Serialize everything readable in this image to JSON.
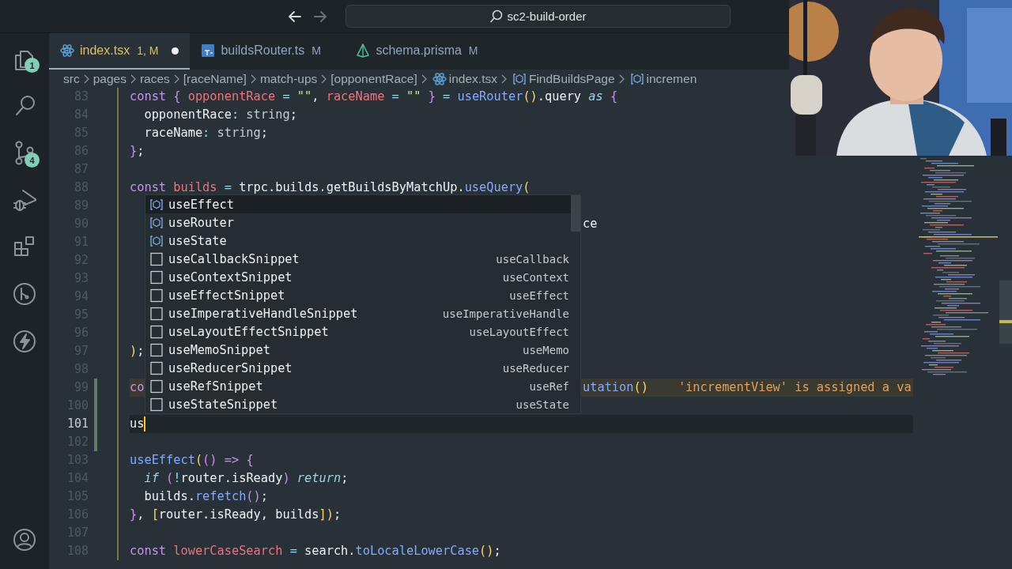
{
  "title_bar": {
    "nav": [
      {
        "kind": "back",
        "disabled": false
      },
      {
        "kind": "forward",
        "disabled": true
      }
    ],
    "command_center": {
      "label": "sc2-build-order"
    }
  },
  "activity_bar": {
    "items": [
      {
        "kind": "files",
        "badge": "1"
      },
      {
        "kind": "search"
      },
      {
        "kind": "source-control",
        "badge": "4"
      },
      {
        "kind": "run-debug"
      },
      {
        "kind": "extensions"
      },
      {
        "kind": "git-graph"
      },
      {
        "kind": "lightning"
      }
    ],
    "bottom_items": [
      {
        "kind": "account"
      }
    ]
  },
  "tabs": [
    {
      "kind": "react",
      "label": "index.tsx",
      "status": "1, M",
      "dirty": true,
      "selected": true
    },
    {
      "kind": "ts",
      "label": "buildsRouter.ts",
      "status": "M",
      "dirty": false,
      "selected": false
    },
    {
      "kind": "prisma",
      "label": "schema.prisma",
      "status": "M",
      "dirty": false,
      "selected": false
    }
  ],
  "breadcrumb": [
    {
      "label": "src"
    },
    {
      "label": "pages"
    },
    {
      "label": "races"
    },
    {
      "label": "[raceName]"
    },
    {
      "label": "match-ups"
    },
    {
      "label": "[opponentRace]"
    },
    {
      "label": "index.tsx",
      "kind": "react"
    },
    {
      "label": "FindBuildsPage",
      "kind": "symbol"
    },
    {
      "label": "incremen",
      "kind": "symbol"
    }
  ],
  "editor": {
    "lines": [
      {
        "number": "83",
        "tokens": [
          {
            "text": "const ",
            "kind": "kw"
          },
          {
            "text": "{ ",
            "kind": "brace"
          },
          {
            "text": "opponentRace ",
            "kind": "var"
          },
          {
            "text": "= ",
            "kind": "op"
          },
          {
            "text": "\"\"",
            "kind": "str"
          },
          {
            "text": ", ",
            "kind": "txt"
          },
          {
            "text": "raceName ",
            "kind": "var"
          },
          {
            "text": "= ",
            "kind": "op"
          },
          {
            "text": "\"\" ",
            "kind": "str"
          },
          {
            "text": "} ",
            "kind": "brace"
          },
          {
            "text": "= ",
            "kind": "op"
          },
          {
            "text": "useRouter",
            "kind": "fn"
          },
          {
            "text": "()",
            "kind": "paren"
          },
          {
            "text": ".query ",
            "kind": "txt"
          },
          {
            "text": "as ",
            "kind": "ctrl"
          },
          {
            "text": "{",
            "kind": "brace"
          }
        ]
      },
      {
        "number": "84",
        "tokens": [
          {
            "text": "  opponentRace",
            "kind": "txt"
          },
          {
            "text": ": ",
            "kind": "op"
          },
          {
            "text": "string",
            "kind": "type"
          },
          {
            "text": ";",
            "kind": "txt"
          }
        ]
      },
      {
        "number": "85",
        "tokens": [
          {
            "text": "  raceName",
            "kind": "txt"
          },
          {
            "text": ": ",
            "kind": "op"
          },
          {
            "text": "string",
            "kind": "type"
          },
          {
            "text": ";",
            "kind": "txt"
          }
        ]
      },
      {
        "number": "86",
        "tokens": [
          {
            "text": "}",
            "kind": "brace"
          },
          {
            "text": ";",
            "kind": "txt"
          }
        ]
      },
      {
        "number": "87"
      },
      {
        "number": "88",
        "tokens": [
          {
            "text": "const ",
            "kind": "kw"
          },
          {
            "text": "builds ",
            "kind": "var"
          },
          {
            "text": "= ",
            "kind": "op"
          },
          {
            "text": "trpc.builds.getBuildsByMatchUp.",
            "kind": "txt"
          },
          {
            "text": "useQuery",
            "kind": "fn"
          },
          {
            "text": "(",
            "kind": "paren"
          }
        ]
      },
      {
        "number": "89"
      },
      {
        "number": "90",
        "right_tokens": [
          {
            "text": "ce",
            "kind": "txt"
          }
        ]
      },
      {
        "number": "91"
      },
      {
        "number": "92"
      },
      {
        "number": "93"
      },
      {
        "number": "94"
      },
      {
        "number": "95"
      },
      {
        "number": "96"
      },
      {
        "number": "97",
        "tokens": [
          {
            "text": ")",
            "kind": "paren"
          },
          {
            "text": ";",
            "kind": "txt"
          }
        ]
      },
      {
        "number": "98"
      },
      {
        "number": "99",
        "tokens": [
          {
            "text": "co",
            "kind": "kw"
          }
        ],
        "right_tokens": [
          {
            "text": "utation",
            "kind": "fn"
          },
          {
            "text": "()",
            "kind": "paren"
          }
        ],
        "diagnostic": "'incrementView' is assigned a va",
        "warning": true,
        "changed": true
      },
      {
        "number": "100",
        "changed": true
      },
      {
        "number": "101",
        "tokens": [
          {
            "text": "us",
            "kind": "txt"
          }
        ],
        "current": true,
        "changed": true
      },
      {
        "number": "102",
        "changed": true
      },
      {
        "number": "103",
        "tokens": [
          {
            "text": "useEffect",
            "kind": "fn"
          },
          {
            "text": "(",
            "kind": "paren"
          },
          {
            "text": "() ",
            "kind": "paren2"
          },
          {
            "text": "=> ",
            "kind": "kw"
          },
          {
            "text": "{",
            "kind": "brace"
          }
        ]
      },
      {
        "number": "104",
        "tokens": [
          {
            "text": "  if ",
            "kind": "ctrl"
          },
          {
            "text": "(",
            "kind": "paren2"
          },
          {
            "text": "!",
            "kind": "op"
          },
          {
            "text": "router.isReady",
            "kind": "txt"
          },
          {
            "text": ") ",
            "kind": "paren2"
          },
          {
            "text": "return",
            "kind": "ctrl"
          },
          {
            "text": ";",
            "kind": "txt"
          }
        ]
      },
      {
        "number": "105",
        "tokens": [
          {
            "text": "  builds.",
            "kind": "txt"
          },
          {
            "text": "refetch",
            "kind": "fn"
          },
          {
            "text": "()",
            "kind": "paren2"
          },
          {
            "text": ";",
            "kind": "txt"
          }
        ]
      },
      {
        "number": "106",
        "tokens": [
          {
            "text": "}",
            "kind": "brace"
          },
          {
            "text": ", ",
            "kind": "txt"
          },
          {
            "text": "[",
            "kind": "paren"
          },
          {
            "text": "router.isReady, builds",
            "kind": "txt"
          },
          {
            "text": "]",
            "kind": "paren"
          },
          {
            "text": ")",
            "kind": "paren"
          },
          {
            "text": ";",
            "kind": "txt"
          }
        ]
      },
      {
        "number": "107"
      },
      {
        "number": "108",
        "tokens": [
          {
            "text": "const ",
            "kind": "kw"
          },
          {
            "text": "lowerCaseSearch ",
            "kind": "var"
          },
          {
            "text": "= ",
            "kind": "op"
          },
          {
            "text": "search.",
            "kind": "txt"
          },
          {
            "text": "toLocaleLowerCase",
            "kind": "fn"
          },
          {
            "text": "()",
            "kind": "paren"
          },
          {
            "text": ";",
            "kind": "txt"
          }
        ]
      }
    ]
  },
  "suggestions": [
    {
      "kind": "variable",
      "label": "useEffect",
      "selected": true
    },
    {
      "kind": "variable",
      "label": "useRouter",
      "selected": false
    },
    {
      "kind": "variable",
      "label": "useState",
      "selected": false
    },
    {
      "kind": "snippet",
      "label": "useCallbackSnippet",
      "detail": "useCallback",
      "selected": false
    },
    {
      "kind": "snippet",
      "label": "useContextSnippet",
      "detail": "useContext",
      "selected": false
    },
    {
      "kind": "snippet",
      "label": "useEffectSnippet",
      "detail": "useEffect",
      "selected": false
    },
    {
      "kind": "snippet",
      "label": "useImperativeHandleSnippet",
      "detail": "useImperativeHandle",
      "selected": false
    },
    {
      "kind": "snippet",
      "label": "useLayoutEffectSnippet",
      "detail": "useLayoutEffect",
      "selected": false
    },
    {
      "kind": "snippet",
      "label": "useMemoSnippet",
      "detail": "useMemo",
      "selected": false
    },
    {
      "kind": "snippet",
      "label": "useReducerSnippet",
      "detail": "useReducer",
      "selected": false
    },
    {
      "kind": "snippet",
      "label": "useRefSnippet",
      "detail": "useRef",
      "selected": false
    },
    {
      "kind": "snippet",
      "label": "useStateSnippet",
      "detail": "useState",
      "selected": false
    }
  ]
}
